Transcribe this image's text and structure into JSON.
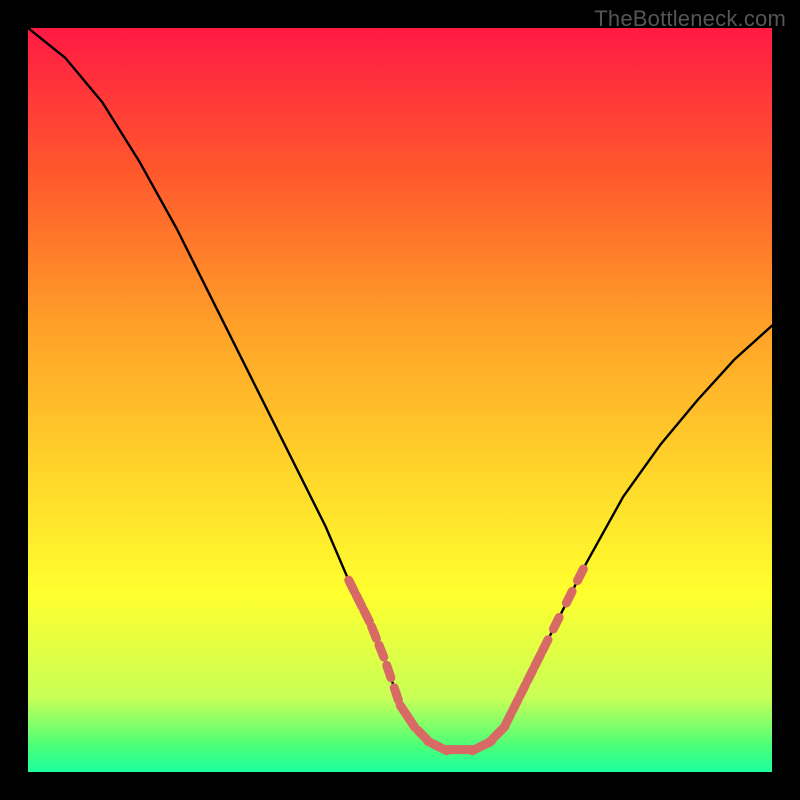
{
  "watermark": "TheBottleneck.com",
  "chart_data": {
    "type": "line",
    "title": "",
    "xlabel": "",
    "ylabel": "",
    "xlim": [
      0,
      100
    ],
    "ylim": [
      0,
      100
    ],
    "grid": false,
    "legend": false,
    "gradient_stops": [
      {
        "offset": 0.0,
        "color": "#ff1a44"
      },
      {
        "offset": 0.2,
        "color": "#ff5a2c"
      },
      {
        "offset": 0.4,
        "color": "#ffa028"
      },
      {
        "offset": 0.6,
        "color": "#ffd62a"
      },
      {
        "offset": 0.76,
        "color": "#ffff2e"
      },
      {
        "offset": 0.9,
        "color": "#c8ff56"
      },
      {
        "offset": 0.965,
        "color": "#4bff78"
      },
      {
        "offset": 1.0,
        "color": "#1cff9f"
      }
    ],
    "series": [
      {
        "name": "bottleneck-curve",
        "style": "solid",
        "color": "#000000",
        "x": [
          0,
          5,
          10,
          15,
          20,
          25,
          30,
          35,
          40,
          43,
          46,
          48,
          50,
          52,
          54,
          56,
          58,
          60,
          62,
          64,
          66,
          70,
          75,
          80,
          85,
          90,
          95,
          100
        ],
        "y": [
          100,
          96,
          90,
          82,
          73,
          63,
          53,
          43,
          33,
          26,
          20,
          15,
          9,
          6,
          4,
          3,
          3,
          3,
          4,
          6,
          10,
          18,
          28,
          37,
          44,
          50,
          55.5,
          60
        ]
      },
      {
        "name": "highlight-left-descent",
        "style": "dotted",
        "color": "#d86a66",
        "x": [
          43.0,
          44.0,
          45.0,
          46.0,
          47.0,
          48.0,
          49.0,
          50.0,
          51.0,
          52.0
        ],
        "y": [
          26.0,
          24.0,
          22.0,
          20.0,
          17.5,
          15.0,
          12.0,
          9.0,
          7.5,
          6.0
        ]
      },
      {
        "name": "highlight-valley",
        "style": "dotted",
        "color": "#d86a66",
        "x": [
          52.0,
          54.0,
          55.0,
          56.0,
          58.0,
          60.0,
          61.0,
          62.0,
          63.0,
          64.0
        ],
        "y": [
          6.0,
          4.0,
          3.5,
          3.0,
          3.0,
          3.0,
          3.5,
          4.0,
          5.0,
          6.0
        ]
      },
      {
        "name": "highlight-right-ascent",
        "style": "dotted",
        "color": "#d86a66",
        "x": [
          64.0,
          65.0,
          66.0,
          67.0,
          68.0,
          69.0,
          70.0,
          72.0,
          73.5,
          75.0
        ],
        "y": [
          6.0,
          8.0,
          10.0,
          12.0,
          14.0,
          16.0,
          18.0,
          22.0,
          25.0,
          28.0
        ]
      }
    ]
  }
}
